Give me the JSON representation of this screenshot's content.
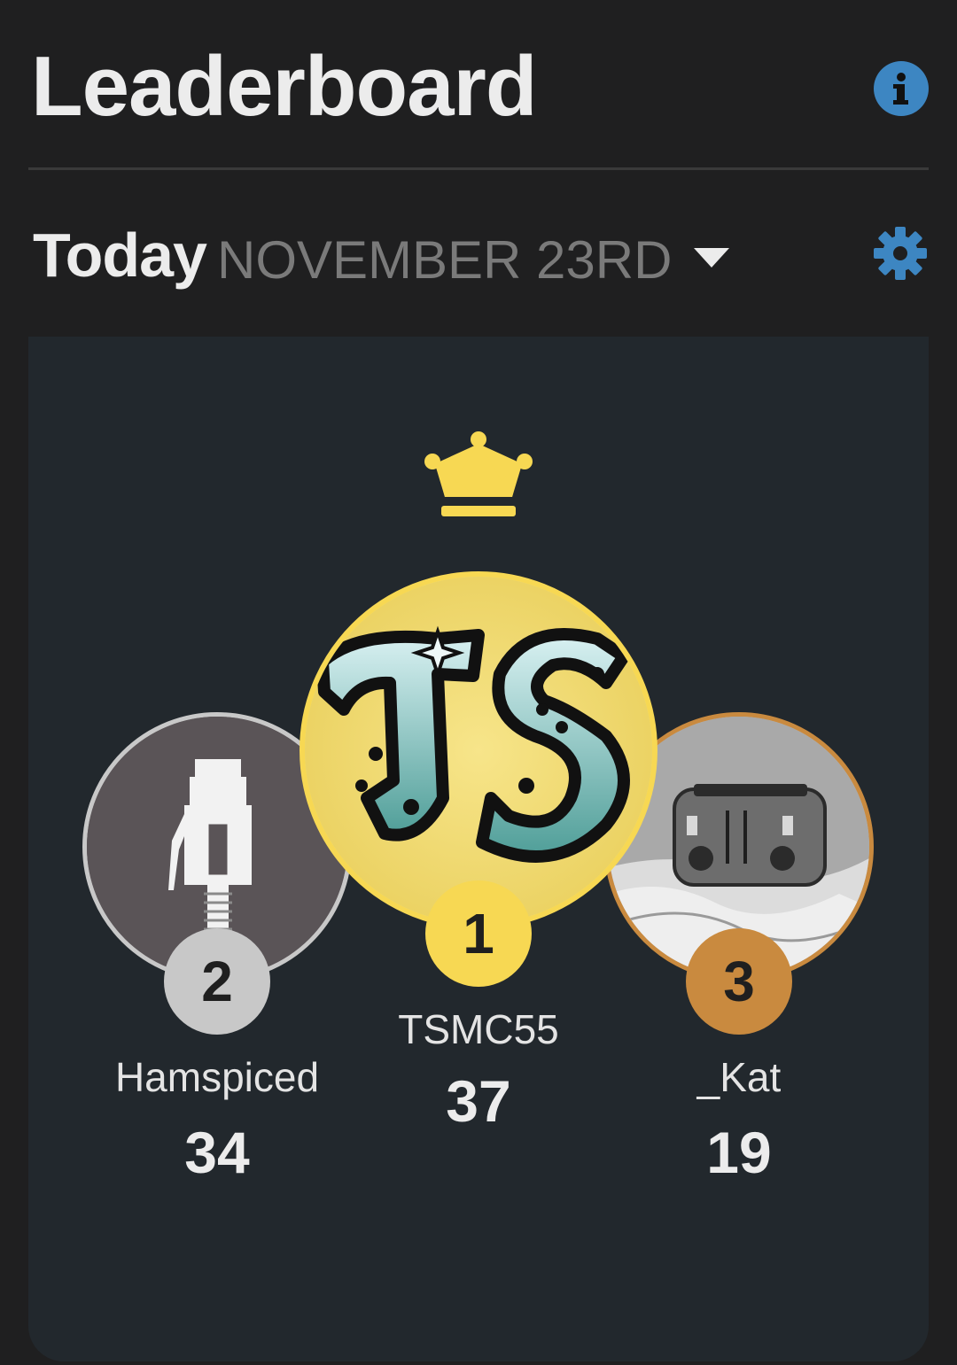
{
  "header": {
    "title": "Leaderboard",
    "info_icon": "info-icon",
    "accent": "#3d86c2"
  },
  "date_row": {
    "period": "Today",
    "date": "NOVEMBER 23RD",
    "dropdown_icon": "caret-down-icon",
    "settings_icon": "gear-icon"
  },
  "podium": [
    {
      "rank": "1",
      "name": "TSMC55",
      "score": "37",
      "badge_color": "#f7d853",
      "avatar": "ts-monogram-avatar"
    },
    {
      "rank": "2",
      "name": "Hamspiced",
      "score": "34",
      "badge_color": "#c8c8c8",
      "avatar": "ethernet-cable-avatar"
    },
    {
      "rank": "3",
      "name": "_Kat",
      "score": "19",
      "badge_color": "#c98a3f",
      "avatar": "toaster-avatar"
    }
  ],
  "crown_icon": "crown-icon"
}
